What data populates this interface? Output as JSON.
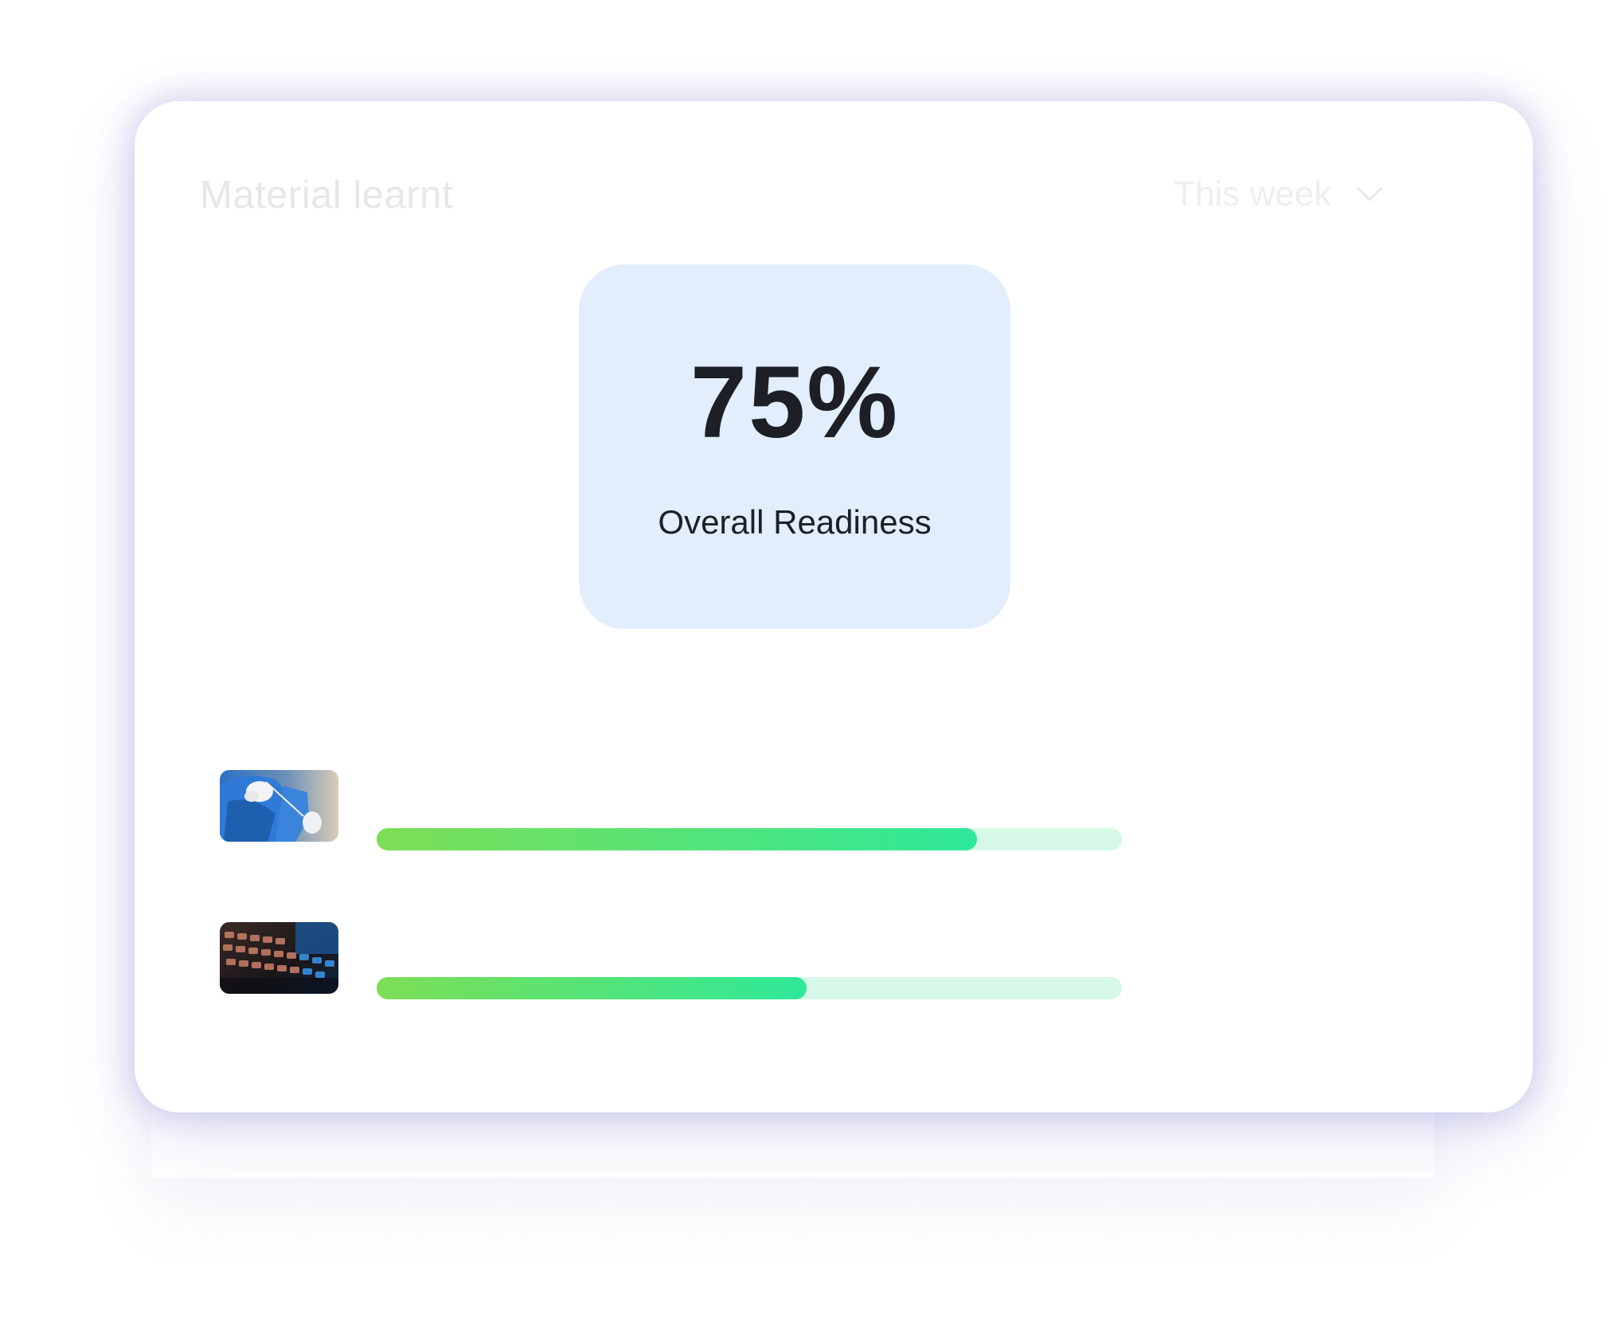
{
  "card": {
    "title": "Material learnt",
    "period_select": {
      "selected": "This week",
      "icon": "chevron-down-icon"
    }
  },
  "readiness": {
    "value": "75%",
    "label": "Overall Readiness",
    "background": "#e2eefc"
  },
  "courses": [
    {
      "thumbnail": "medical-ppe-photo",
      "progress": 0.806
    },
    {
      "thumbnail": "keyboard-photo",
      "progress": 0.577
    }
  ],
  "colors": {
    "progress_start": "#7dde55",
    "progress_end": "#2ee99a",
    "track": "#d6f8e7",
    "text_dark": "#1c1f26"
  }
}
